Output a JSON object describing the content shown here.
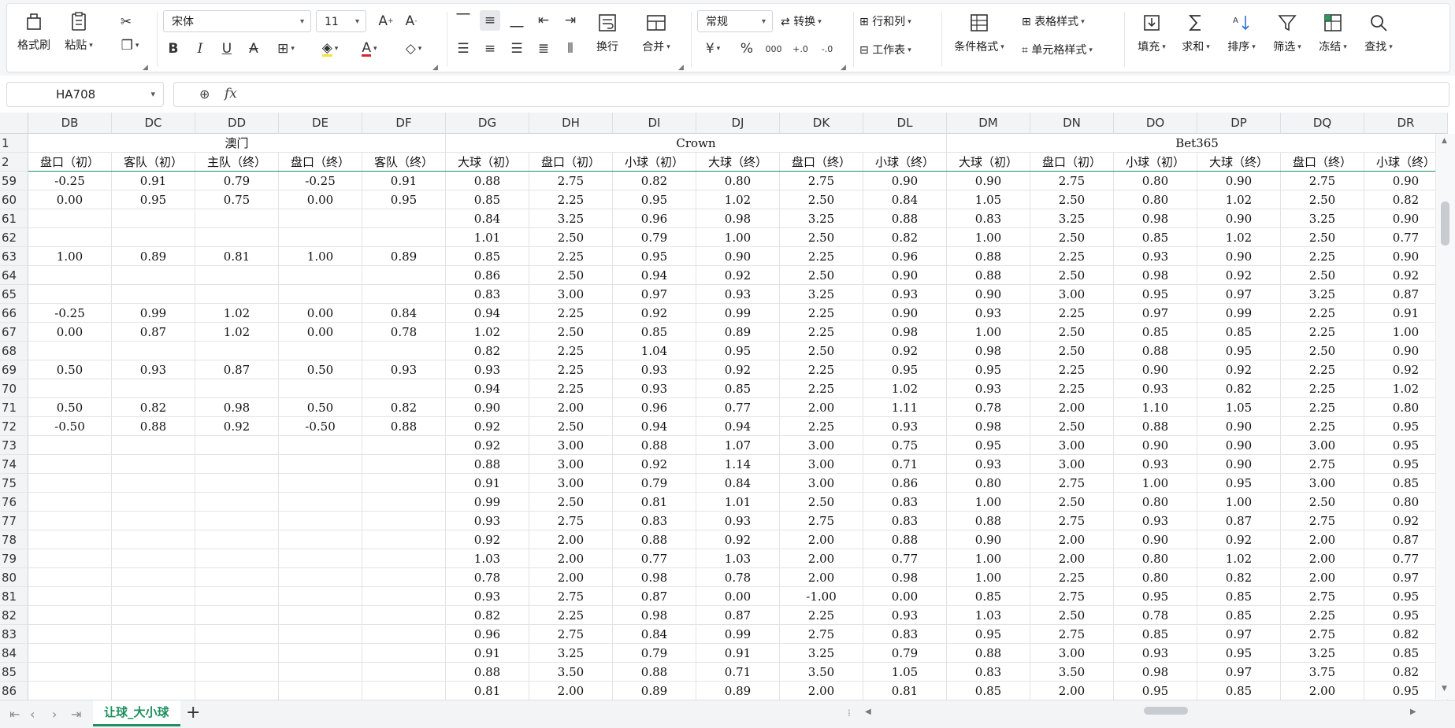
{
  "ribbon": {
    "format_painter": "格式刷",
    "paste": "粘贴",
    "font_name": "宋体",
    "font_size": "11",
    "wrap": "换行",
    "merge": "合并",
    "number_format": "常规",
    "convert": "转换",
    "row_col": "行和列",
    "worksheet": "工作表",
    "cond_format": "条件格式",
    "table_style": "表格样式",
    "cell_style": "单元格样式",
    "fill": "填充",
    "sum": "求和",
    "sort": "排序",
    "filter": "筛选",
    "freeze": "冻结",
    "find": "查找"
  },
  "formula_bar": {
    "name_box": "HA708",
    "fx": "fx",
    "content": ""
  },
  "columns": [
    "DB",
    "DC",
    "DD",
    "DE",
    "DF",
    "DG",
    "DH",
    "DI",
    "DJ",
    "DK",
    "DL",
    "DM",
    "DN",
    "DO",
    "DP",
    "DQ",
    "DR"
  ],
  "group_headers": [
    {
      "label": "澳门",
      "start": 0,
      "span": 5
    },
    {
      "label": "Crown",
      "start": 5,
      "span": 6
    },
    {
      "label": "Bet365",
      "start": 11,
      "span": 6
    }
  ],
  "row2_headers": [
    "盘口（初）",
    "客队（初）",
    "主队（终）",
    "盘口（终）",
    "客队（终）",
    "大球（初）",
    "盘口（初）",
    "小球（初）",
    "大球（终）",
    "盘口（终）",
    "小球（终）",
    "大球（初）",
    "盘口（初）",
    "小球（初）",
    "大球（终）",
    "盘口（终）",
    "小球（终）"
  ],
  "rows": [
    {
      "n": "59",
      "c": [
        "-0.25",
        "0.91",
        "0.79",
        "-0.25",
        "0.91",
        "0.88",
        "2.75",
        "0.82",
        "0.80",
        "2.75",
        "0.90",
        "0.90",
        "2.75",
        "0.80",
        "0.90",
        "2.75",
        "0.90"
      ]
    },
    {
      "n": "60",
      "c": [
        "0.00",
        "0.95",
        "0.75",
        "0.00",
        "0.95",
        "0.85",
        "2.25",
        "0.95",
        "1.02",
        "2.50",
        "0.84",
        "1.05",
        "2.50",
        "0.80",
        "1.02",
        "2.50",
        "0.82"
      ]
    },
    {
      "n": "61",
      "c": [
        "",
        "",
        "",
        "",
        "",
        "0.84",
        "3.25",
        "0.96",
        "0.98",
        "3.25",
        "0.88",
        "0.83",
        "3.25",
        "0.98",
        "0.90",
        "3.25",
        "0.90"
      ]
    },
    {
      "n": "62",
      "c": [
        "",
        "",
        "",
        "",
        "",
        "1.01",
        "2.50",
        "0.79",
        "1.00",
        "2.50",
        "0.82",
        "1.00",
        "2.50",
        "0.85",
        "1.02",
        "2.50",
        "0.77"
      ]
    },
    {
      "n": "63",
      "c": [
        "1.00",
        "0.89",
        "0.81",
        "1.00",
        "0.89",
        "0.85",
        "2.25",
        "0.95",
        "0.90",
        "2.25",
        "0.96",
        "0.88",
        "2.25",
        "0.93",
        "0.90",
        "2.25",
        "0.90"
      ]
    },
    {
      "n": "64",
      "c": [
        "",
        "",
        "",
        "",
        "",
        "0.86",
        "2.50",
        "0.94",
        "0.92",
        "2.50",
        "0.90",
        "0.88",
        "2.50",
        "0.98",
        "0.92",
        "2.50",
        "0.92"
      ]
    },
    {
      "n": "65",
      "c": [
        "",
        "",
        "",
        "",
        "",
        "0.83",
        "3.00",
        "0.97",
        "0.93",
        "3.25",
        "0.93",
        "0.90",
        "3.00",
        "0.95",
        "0.97",
        "3.25",
        "0.87"
      ]
    },
    {
      "n": "66",
      "c": [
        "-0.25",
        "0.99",
        "1.02",
        "0.00",
        "0.84",
        "0.94",
        "2.25",
        "0.92",
        "0.99",
        "2.25",
        "0.90",
        "0.93",
        "2.25",
        "0.97",
        "0.99",
        "2.25",
        "0.91"
      ]
    },
    {
      "n": "67",
      "c": [
        "0.00",
        "0.87",
        "1.02",
        "0.00",
        "0.78",
        "1.02",
        "2.50",
        "0.85",
        "0.89",
        "2.25",
        "0.98",
        "1.00",
        "2.50",
        "0.85",
        "0.85",
        "2.25",
        "1.00"
      ]
    },
    {
      "n": "68",
      "c": [
        "",
        "",
        "",
        "",
        "",
        "0.82",
        "2.25",
        "1.04",
        "0.95",
        "2.50",
        "0.92",
        "0.98",
        "2.50",
        "0.88",
        "0.95",
        "2.50",
        "0.90"
      ]
    },
    {
      "n": "69",
      "c": [
        "0.50",
        "0.93",
        "0.87",
        "0.50",
        "0.93",
        "0.93",
        "2.25",
        "0.93",
        "0.92",
        "2.25",
        "0.95",
        "0.95",
        "2.25",
        "0.90",
        "0.92",
        "2.25",
        "0.92"
      ]
    },
    {
      "n": "70",
      "c": [
        "",
        "",
        "",
        "",
        "",
        "0.94",
        "2.25",
        "0.93",
        "0.85",
        "2.25",
        "1.02",
        "0.93",
        "2.25",
        "0.93",
        "0.82",
        "2.25",
        "1.02"
      ]
    },
    {
      "n": "71",
      "c": [
        "0.50",
        "0.82",
        "0.98",
        "0.50",
        "0.82",
        "0.90",
        "2.00",
        "0.96",
        "0.77",
        "2.00",
        "1.11",
        "0.78",
        "2.00",
        "1.10",
        "1.05",
        "2.25",
        "0.80"
      ]
    },
    {
      "n": "72",
      "c": [
        "-0.50",
        "0.88",
        "0.92",
        "-0.50",
        "0.88",
        "0.92",
        "2.50",
        "0.94",
        "0.94",
        "2.25",
        "0.93",
        "0.98",
        "2.50",
        "0.88",
        "0.90",
        "2.25",
        "0.95"
      ]
    },
    {
      "n": "73",
      "c": [
        "",
        "",
        "",
        "",
        "",
        "0.92",
        "3.00",
        "0.88",
        "1.07",
        "3.00",
        "0.75",
        "0.95",
        "3.00",
        "0.90",
        "0.90",
        "3.00",
        "0.95"
      ]
    },
    {
      "n": "74",
      "c": [
        "",
        "",
        "",
        "",
        "",
        "0.88",
        "3.00",
        "0.92",
        "1.14",
        "3.00",
        "0.71",
        "0.93",
        "3.00",
        "0.93",
        "0.90",
        "2.75",
        "0.95"
      ]
    },
    {
      "n": "75",
      "c": [
        "",
        "",
        "",
        "",
        "",
        "0.91",
        "3.00",
        "0.79",
        "0.84",
        "3.00",
        "0.86",
        "0.80",
        "2.75",
        "1.00",
        "0.95",
        "3.00",
        "0.85"
      ]
    },
    {
      "n": "76",
      "c": [
        "",
        "",
        "",
        "",
        "",
        "0.99",
        "2.50",
        "0.81",
        "1.01",
        "2.50",
        "0.83",
        "1.00",
        "2.50",
        "0.80",
        "1.00",
        "2.50",
        "0.80"
      ]
    },
    {
      "n": "77",
      "c": [
        "",
        "",
        "",
        "",
        "",
        "0.93",
        "2.75",
        "0.83",
        "0.93",
        "2.75",
        "0.83",
        "0.88",
        "2.75",
        "0.93",
        "0.87",
        "2.75",
        "0.92"
      ]
    },
    {
      "n": "78",
      "c": [
        "",
        "",
        "",
        "",
        "",
        "0.92",
        "2.00",
        "0.88",
        "0.92",
        "2.00",
        "0.88",
        "0.90",
        "2.00",
        "0.90",
        "0.92",
        "2.00",
        "0.87"
      ]
    },
    {
      "n": "79",
      "c": [
        "",
        "",
        "",
        "",
        "",
        "1.03",
        "2.00",
        "0.77",
        "1.03",
        "2.00",
        "0.77",
        "1.00",
        "2.00",
        "0.80",
        "1.02",
        "2.00",
        "0.77"
      ]
    },
    {
      "n": "80",
      "c": [
        "",
        "",
        "",
        "",
        "",
        "0.78",
        "2.00",
        "0.98",
        "0.78",
        "2.00",
        "0.98",
        "1.00",
        "2.25",
        "0.80",
        "0.82",
        "2.00",
        "0.97"
      ]
    },
    {
      "n": "81",
      "c": [
        "",
        "",
        "",
        "",
        "",
        "0.93",
        "2.75",
        "0.87",
        "0.00",
        "-1.00",
        "0.00",
        "0.85",
        "2.75",
        "0.95",
        "0.85",
        "2.75",
        "0.95"
      ]
    },
    {
      "n": "82",
      "c": [
        "",
        "",
        "",
        "",
        "",
        "0.82",
        "2.25",
        "0.98",
        "0.87",
        "2.25",
        "0.93",
        "1.03",
        "2.50",
        "0.78",
        "0.85",
        "2.25",
        "0.95"
      ]
    },
    {
      "n": "83",
      "c": [
        "",
        "",
        "",
        "",
        "",
        "0.96",
        "2.75",
        "0.84",
        "0.99",
        "2.75",
        "0.83",
        "0.95",
        "2.75",
        "0.85",
        "0.97",
        "2.75",
        "0.82"
      ]
    },
    {
      "n": "84",
      "c": [
        "",
        "",
        "",
        "",
        "",
        "0.91",
        "3.25",
        "0.79",
        "0.91",
        "3.25",
        "0.79",
        "0.88",
        "3.00",
        "0.93",
        "0.95",
        "3.25",
        "0.85"
      ]
    },
    {
      "n": "85",
      "c": [
        "",
        "",
        "",
        "",
        "",
        "0.88",
        "3.50",
        "0.88",
        "0.71",
        "3.50",
        "1.05",
        "0.83",
        "3.50",
        "0.98",
        "0.97",
        "3.75",
        "0.82"
      ]
    },
    {
      "n": "86",
      "c": [
        "",
        "",
        "",
        "",
        "",
        "0.81",
        "2.00",
        "0.89",
        "0.89",
        "2.00",
        "0.81",
        "0.85",
        "2.00",
        "0.95",
        "0.85",
        "2.00",
        "0.95"
      ]
    }
  ],
  "sheet": {
    "tab": "让球_大小球",
    "add": "+"
  },
  "colors": {
    "accent": "#1f8f5f",
    "header_bg": "#f3f4f6"
  }
}
